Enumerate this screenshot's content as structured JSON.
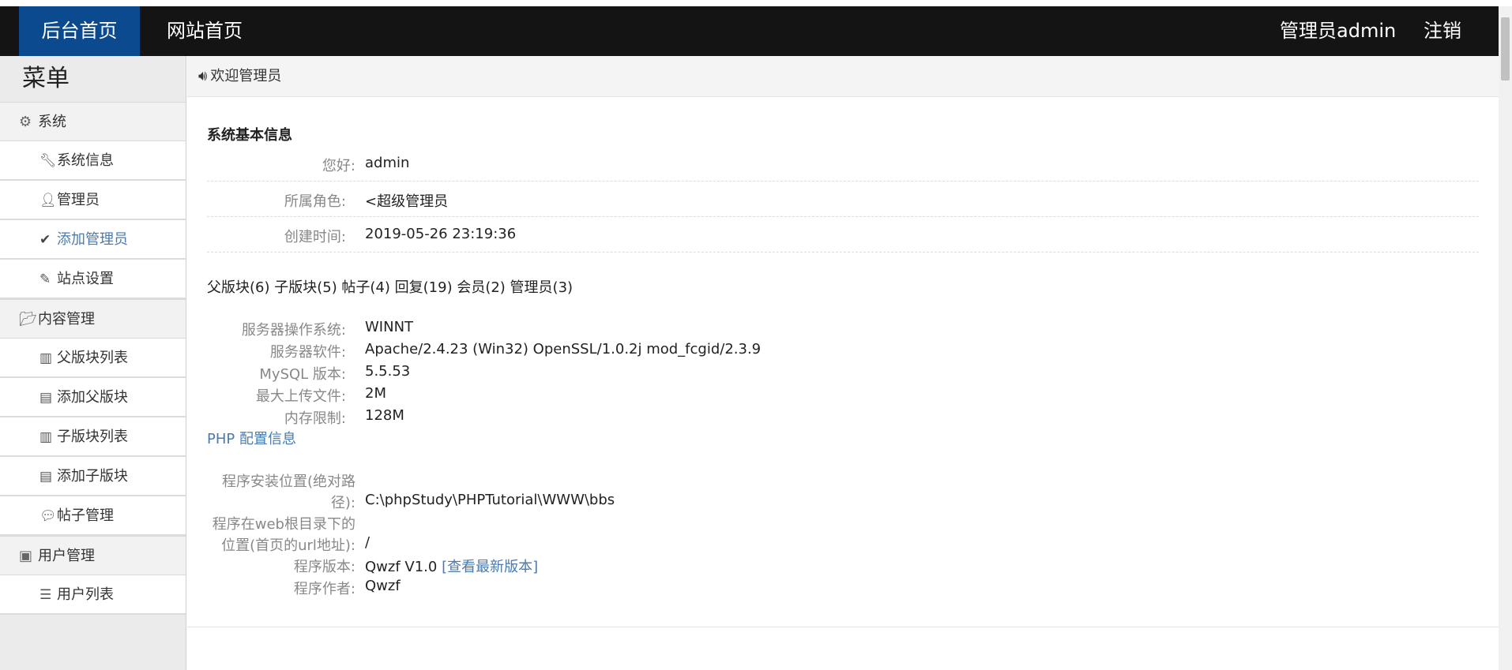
{
  "topbar": {
    "nav_home": "后台首页",
    "nav_site": "网站首页",
    "user": "管理员admin",
    "logout": "注销"
  },
  "sidebar": {
    "title": "菜单",
    "groups": [
      {
        "label": "系统",
        "icon": "gear-icon",
        "items": [
          {
            "label": "系统信息",
            "icon": "wrench-icon"
          },
          {
            "label": "管理员",
            "icon": "user-icon"
          },
          {
            "label": "添加管理员",
            "icon": "check-icon",
            "active": true
          },
          {
            "label": "站点设置",
            "icon": "pencil-icon"
          }
        ]
      },
      {
        "label": "内容管理",
        "icon": "folder-open-icon",
        "items": [
          {
            "label": "父版块列表",
            "icon": "books-icon"
          },
          {
            "label": "添加父版块",
            "icon": "list-alt-icon"
          },
          {
            "label": "子版块列表",
            "icon": "books-icon"
          },
          {
            "label": "添加子版块",
            "icon": "list-alt-icon"
          },
          {
            "label": "帖子管理",
            "icon": "comment-icon"
          }
        ]
      },
      {
        "label": "用户管理",
        "icon": "address-book-icon",
        "items": [
          {
            "label": "用户列表",
            "icon": "list-icon"
          }
        ]
      }
    ]
  },
  "crumb": {
    "text": "欢迎管理员",
    "icon": "volume-icon"
  },
  "main": {
    "section_title": "系统基本信息",
    "greeting_label": "您好:",
    "greeting_value": "admin",
    "role_label": "所属角色:",
    "role_value": "<超级管理员",
    "created_label": "创建时间:",
    "created_value": "2019-05-26 23:19:36",
    "stats": "父版块(6) 子版块(5) 帖子(4) 回复(19) 会员(2) 管理员(3)",
    "server": [
      {
        "label": "服务器操作系统:",
        "value": "WINNT"
      },
      {
        "label": "服务器软件:",
        "value": "Apache/2.4.23 (Win32) OpenSSL/1.0.2j mod_fcgid/2.3.9"
      },
      {
        "label": "MySQL 版本:",
        "value": "5.5.53"
      },
      {
        "label": "最大上传文件:",
        "value": "2M"
      },
      {
        "label": "内存限制:",
        "value": "128M"
      }
    ],
    "php_link": "PHP 配置信息",
    "install_label_line1": "程序安装位置(绝对路",
    "install_label_line2": "径):",
    "install_value": "C:\\phpStudy\\PHPTutorial\\WWW\\bbs",
    "url_label_line1": "程序在web根目录下的",
    "url_label_line2": "位置(首页的url地址):",
    "url_value": "/",
    "version_label": "程序版本:",
    "version_value": "Qwzf V1.0",
    "version_link": "[查看最新版本]",
    "author_label": "程序作者:",
    "author_value": "Qwzf"
  }
}
